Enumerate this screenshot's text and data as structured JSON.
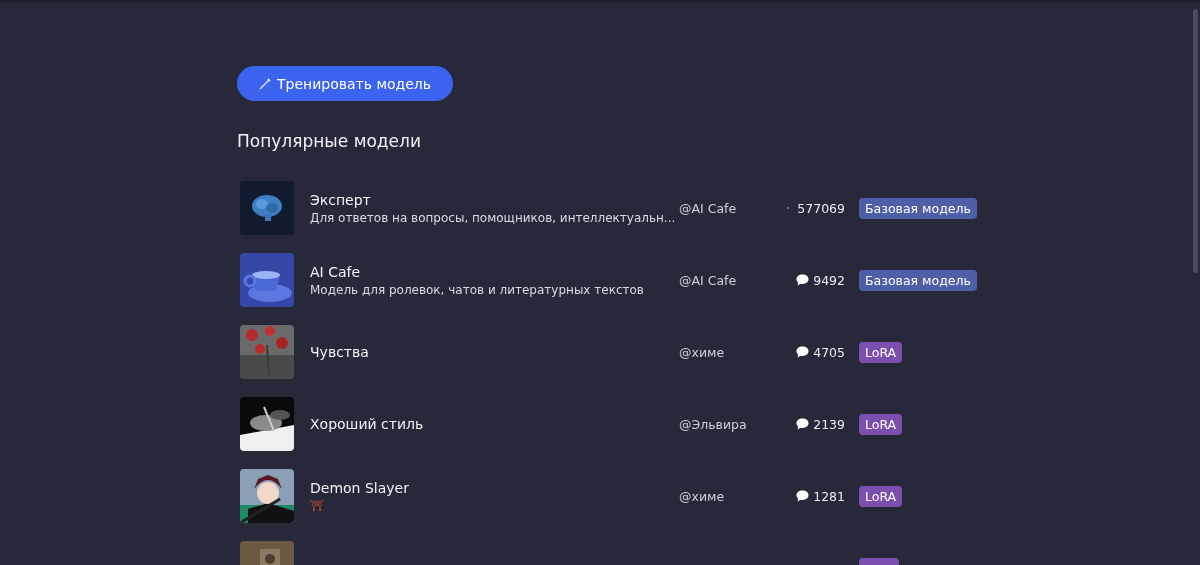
{
  "train_button": {
    "label": "Тренировать модель"
  },
  "section_title": "Популярные модели",
  "models": [
    {
      "name": "Эксперт",
      "description": "Для ответов на вопросы, помощников, интеллектуальн...",
      "author": "@AI Cafe",
      "count": {
        "kind": "dot",
        "text": "577069"
      },
      "badge": {
        "label": "Базовая модель",
        "color": "#4e5fa8"
      }
    },
    {
      "name": "AI Cafe",
      "description": "Модель для ролевок, чатов и литературных текстов",
      "author": "@AI Cafe",
      "count": {
        "kind": "bubble",
        "text": "9492"
      },
      "badge": {
        "label": "Базовая модель",
        "color": "#4e5fa8"
      }
    },
    {
      "name": "Чувства",
      "author": "@химе",
      "count": {
        "kind": "bubble",
        "text": "4705"
      },
      "badge": {
        "label": "LoRA",
        "color": "#7a4fb0"
      }
    },
    {
      "name": "Хороший стиль",
      "author": "@Эльвира",
      "count": {
        "kind": "bubble",
        "text": "2139"
      },
      "badge": {
        "label": "LoRA",
        "color": "#7a4fb0"
      }
    },
    {
      "name": "Demon Slayer",
      "description": "⛩",
      "author": "@химе",
      "count": {
        "kind": "bubble",
        "text": "1281"
      },
      "badge": {
        "label": "LoRA",
        "color": "#7a4fb0"
      }
    },
    {
      "badge": {
        "color": "#7a4fb0"
      }
    }
  ]
}
